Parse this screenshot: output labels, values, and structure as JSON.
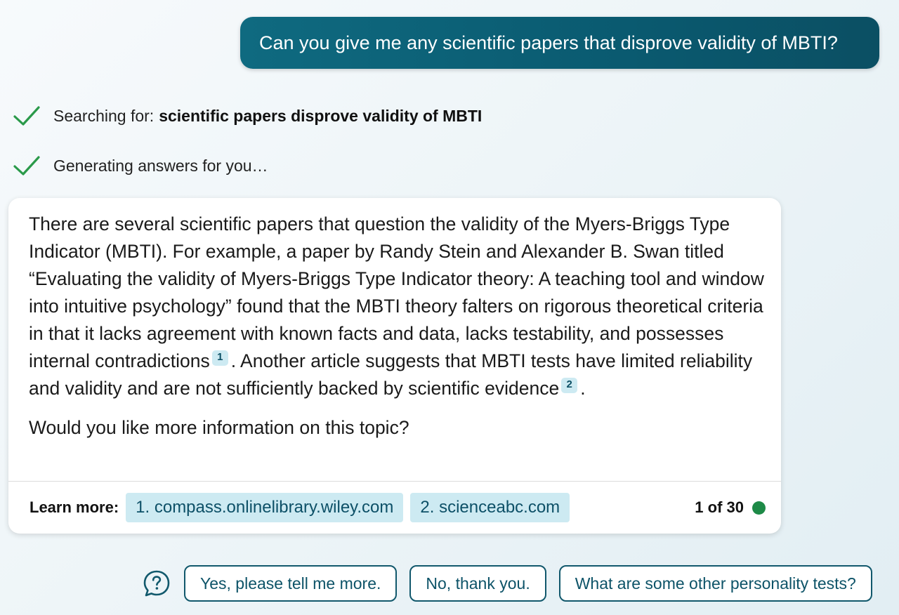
{
  "user_message": "Can you give me any scientific papers that disprove validity of MBTI?",
  "status": {
    "searching_label": "Searching for:",
    "searching_query": "scientific papers disprove validity of MBTI",
    "generating_label": "Generating answers for you…"
  },
  "answer": {
    "p1_a": "There are several scientific papers that question the validity of the Myers-Briggs Type Indicator (MBTI). For example, a paper by Randy Stein and Alexander B. Swan titled “Evaluating the validity of Myers-Briggs Type Indicator theory: A teaching tool and window into intuitive psychology” found that the MBTI theory falters on rigorous theoretical criteria in that it lacks agreement with known facts and data, lacks testability, and possesses internal contradictions",
    "cite_1": "1",
    "p1_b": ". Another article suggests that MBTI tests have limited reliability and validity and are not sufficiently backed by scientific evidence",
    "cite_2": "2",
    "p1_c": ".",
    "p2": "Would you like more information on this topic?"
  },
  "learn_more": {
    "label": "Learn more:",
    "sources": [
      "1. compass.onlinelibrary.wiley.com",
      "2. scienceabc.com"
    ]
  },
  "counter": "1 of 30",
  "counter_dot_color": "#1d8a47",
  "suggestions": [
    "Yes, please tell me more.",
    "No, thank you.",
    "What are some other personality tests?"
  ],
  "colors": {
    "user_bubble": "#0a5a70",
    "check": "#2a9a4a",
    "accent": "#11586c",
    "chip_bg": "#cdeaf2"
  }
}
